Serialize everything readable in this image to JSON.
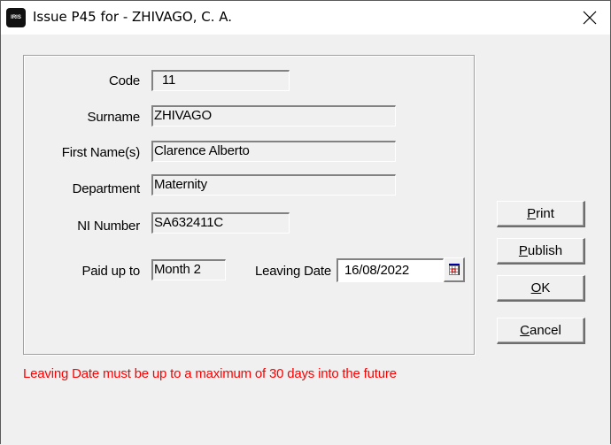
{
  "window": {
    "title": "Issue P45 for - ZHIVAGO, C. A.",
    "app_icon_text": "IRIS",
    "app_icon": "iris-logo-icon",
    "close_icon": "close-icon"
  },
  "form": {
    "code": {
      "label": "Code",
      "value": "11"
    },
    "surname": {
      "label": "Surname",
      "value": "ZHIVAGO"
    },
    "first_names": {
      "label": "First Name(s)",
      "value": "Clarence Alberto"
    },
    "department": {
      "label": "Department",
      "value": "Maternity"
    },
    "ni_number": {
      "label": "NI Number",
      "value": "SA632411C"
    },
    "paid_up_to": {
      "label": "Paid up to",
      "value": "Month 2"
    },
    "leaving_date": {
      "label": "Leaving Date",
      "value": "16/08/2022",
      "picker_icon": "calendar-icon"
    }
  },
  "buttons": {
    "print": {
      "accel": "P",
      "rest": "rint"
    },
    "publish": {
      "accel": "P",
      "rest": "ublish"
    },
    "ok": {
      "accel": "O",
      "rest": "K"
    },
    "cancel": {
      "accel": "C",
      "rest": "ancel"
    }
  },
  "error_message": "Leaving Date must be up to a maximum of 30 days into the future",
  "colors": {
    "error": "#ff0000",
    "background": "#f0f0f0",
    "titlebar": "#ffffff"
  }
}
